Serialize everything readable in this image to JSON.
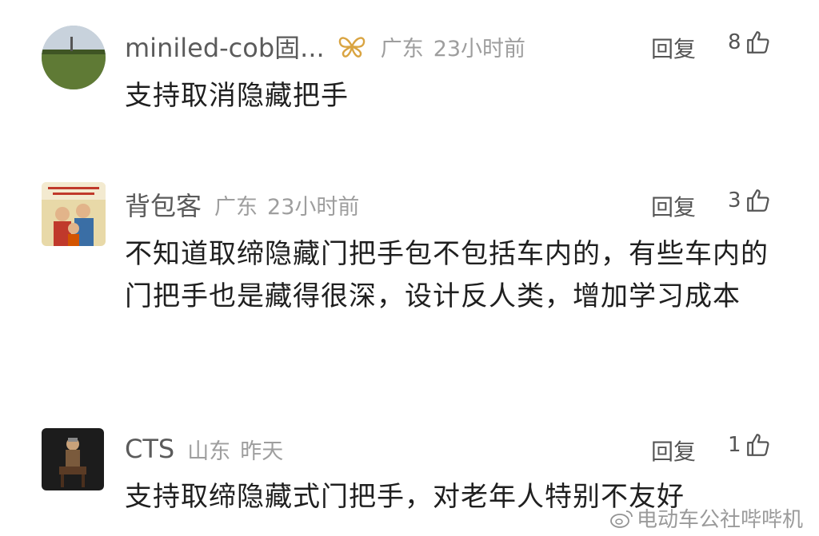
{
  "comments": [
    {
      "username": "miniled-cob固...",
      "location": "广东",
      "time": "23小时前",
      "reply_label": "回复",
      "likes": "8",
      "text": "支持取消隐藏把手",
      "has_badge": true
    },
    {
      "username": "背包客",
      "location": "广东",
      "time": "23小时前",
      "reply_label": "回复",
      "likes": "3",
      "text": "不知道取缔隐藏门把手包不包括车内的，有些车内的门把手也是藏得很深，设计反人类，增加学习成本"
    },
    {
      "username": "CTS",
      "location": "山东",
      "time": "昨天",
      "reply_label": "回复",
      "likes": "1",
      "text": "支持取缔隐藏式门把手，对老年人特别不友好"
    }
  ],
  "watermark": "电动车公社哔哔机",
  "icons": {
    "like": "thumbs-up-icon",
    "badge": "butterfly-badge-icon",
    "watermark": "weibo-icon"
  },
  "colors": {
    "username": "#5b5b5b",
    "meta": "#9e9e9e",
    "text": "#1f1f1f",
    "badge": "#d9a441"
  }
}
